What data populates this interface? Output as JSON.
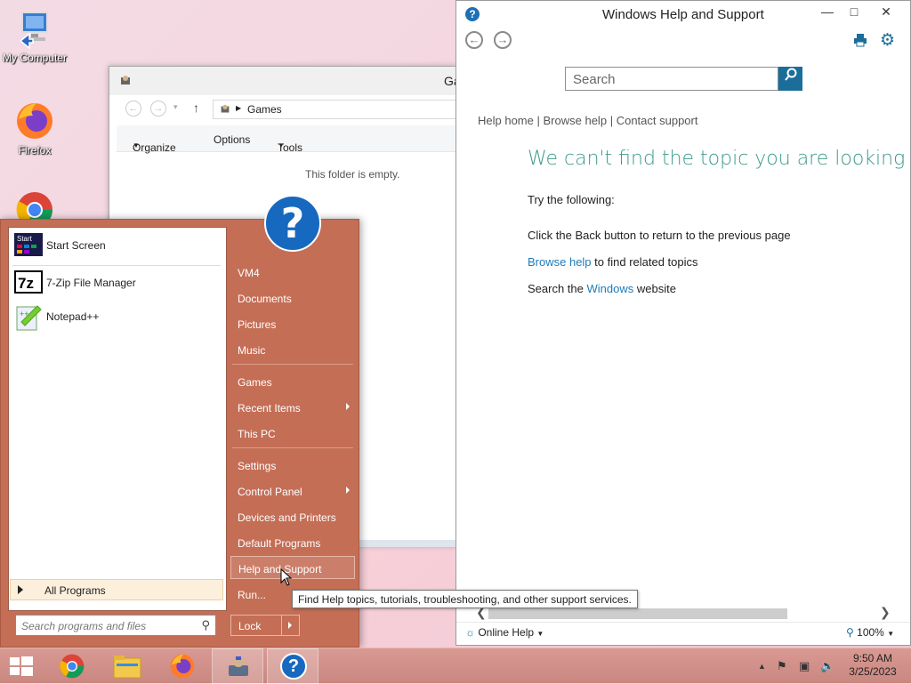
{
  "desktop": {
    "icons": [
      {
        "label": "My Computer",
        "icon": "computer-icon"
      },
      {
        "label": "Firefox",
        "icon": "firefox-icon"
      },
      {
        "label": "",
        "icon": "chrome-icon"
      }
    ]
  },
  "explorer": {
    "title": "Ga",
    "breadcrumb": "Games",
    "toolbar": {
      "organize": "Organize",
      "options": "Options",
      "tools": "Tools"
    },
    "empty_message": "This folder is empty."
  },
  "help": {
    "title": "Windows Help and Support",
    "search_placeholder": "Search",
    "crumbs": {
      "home": "Help home",
      "browse": "Browse help",
      "contact": "Contact support",
      "sep": "|"
    },
    "heading": "We can't find the topic you are looking for",
    "try_following": "Try the following:",
    "back_tip": "Click the Back button to return to the previous page",
    "browse_link": "Browse help",
    "browse_rest": "to find related topics",
    "search_pre": "Search the",
    "windows_link": "Windows",
    "search_post": "website",
    "online_help": "Online Help",
    "zoom": "100%"
  },
  "startmenu": {
    "programs": [
      {
        "label": "Start Screen",
        "icon": "start-screen-icon"
      },
      {
        "label": "7-Zip File Manager",
        "icon": "7zip-icon"
      },
      {
        "label": "Notepad++",
        "icon": "notepadpp-icon"
      }
    ],
    "all_programs": "All Programs",
    "search_placeholder": "Search programs and files",
    "right_items": [
      {
        "label": "VM4"
      },
      {
        "label": "Documents"
      },
      {
        "label": "Pictures"
      },
      {
        "label": "Music"
      },
      {
        "label": "Games"
      },
      {
        "label": "Recent Items"
      },
      {
        "label": "This PC"
      },
      {
        "label": "Settings"
      },
      {
        "label": "Control Panel"
      },
      {
        "label": "Devices and Printers"
      },
      {
        "label": "Default Programs"
      },
      {
        "label": "Help and Support"
      },
      {
        "label": "Run..."
      }
    ],
    "lock": "Lock",
    "user_pic_glyph": "?"
  },
  "tooltip": "Find Help topics, tutorials, troubleshooting, and other support services.",
  "taskbar": {
    "time": "9:50 AM",
    "date": "3/25/2023",
    "buttons": [
      "start-icon",
      "chrome-icon",
      "file-explorer-icon",
      "firefox-icon",
      "games-icon",
      "help-icon"
    ]
  },
  "colors": {
    "accent": "#c46e56",
    "help_heading": "#3c9a8a",
    "link": "#1e7bb8"
  }
}
